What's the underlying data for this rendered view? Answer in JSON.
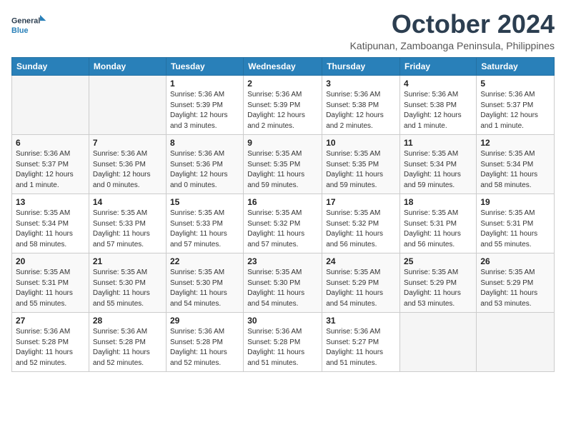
{
  "logo": {
    "line1": "General",
    "line2": "Blue"
  },
  "title": "October 2024",
  "location": "Katipunan, Zamboanga Peninsula, Philippines",
  "headers": [
    "Sunday",
    "Monday",
    "Tuesday",
    "Wednesday",
    "Thursday",
    "Friday",
    "Saturday"
  ],
  "weeks": [
    [
      {
        "day": "",
        "info": ""
      },
      {
        "day": "",
        "info": ""
      },
      {
        "day": "1",
        "info": "Sunrise: 5:36 AM\nSunset: 5:39 PM\nDaylight: 12 hours and 3 minutes."
      },
      {
        "day": "2",
        "info": "Sunrise: 5:36 AM\nSunset: 5:39 PM\nDaylight: 12 hours and 2 minutes."
      },
      {
        "day": "3",
        "info": "Sunrise: 5:36 AM\nSunset: 5:38 PM\nDaylight: 12 hours and 2 minutes."
      },
      {
        "day": "4",
        "info": "Sunrise: 5:36 AM\nSunset: 5:38 PM\nDaylight: 12 hours and 1 minute."
      },
      {
        "day": "5",
        "info": "Sunrise: 5:36 AM\nSunset: 5:37 PM\nDaylight: 12 hours and 1 minute."
      }
    ],
    [
      {
        "day": "6",
        "info": "Sunrise: 5:36 AM\nSunset: 5:37 PM\nDaylight: 12 hours and 1 minute."
      },
      {
        "day": "7",
        "info": "Sunrise: 5:36 AM\nSunset: 5:36 PM\nDaylight: 12 hours and 0 minutes."
      },
      {
        "day": "8",
        "info": "Sunrise: 5:36 AM\nSunset: 5:36 PM\nDaylight: 12 hours and 0 minutes."
      },
      {
        "day": "9",
        "info": "Sunrise: 5:35 AM\nSunset: 5:35 PM\nDaylight: 11 hours and 59 minutes."
      },
      {
        "day": "10",
        "info": "Sunrise: 5:35 AM\nSunset: 5:35 PM\nDaylight: 11 hours and 59 minutes."
      },
      {
        "day": "11",
        "info": "Sunrise: 5:35 AM\nSunset: 5:34 PM\nDaylight: 11 hours and 59 minutes."
      },
      {
        "day": "12",
        "info": "Sunrise: 5:35 AM\nSunset: 5:34 PM\nDaylight: 11 hours and 58 minutes."
      }
    ],
    [
      {
        "day": "13",
        "info": "Sunrise: 5:35 AM\nSunset: 5:34 PM\nDaylight: 11 hours and 58 minutes."
      },
      {
        "day": "14",
        "info": "Sunrise: 5:35 AM\nSunset: 5:33 PM\nDaylight: 11 hours and 57 minutes."
      },
      {
        "day": "15",
        "info": "Sunrise: 5:35 AM\nSunset: 5:33 PM\nDaylight: 11 hours and 57 minutes."
      },
      {
        "day": "16",
        "info": "Sunrise: 5:35 AM\nSunset: 5:32 PM\nDaylight: 11 hours and 57 minutes."
      },
      {
        "day": "17",
        "info": "Sunrise: 5:35 AM\nSunset: 5:32 PM\nDaylight: 11 hours and 56 minutes."
      },
      {
        "day": "18",
        "info": "Sunrise: 5:35 AM\nSunset: 5:31 PM\nDaylight: 11 hours and 56 minutes."
      },
      {
        "day": "19",
        "info": "Sunrise: 5:35 AM\nSunset: 5:31 PM\nDaylight: 11 hours and 55 minutes."
      }
    ],
    [
      {
        "day": "20",
        "info": "Sunrise: 5:35 AM\nSunset: 5:31 PM\nDaylight: 11 hours and 55 minutes."
      },
      {
        "day": "21",
        "info": "Sunrise: 5:35 AM\nSunset: 5:30 PM\nDaylight: 11 hours and 55 minutes."
      },
      {
        "day": "22",
        "info": "Sunrise: 5:35 AM\nSunset: 5:30 PM\nDaylight: 11 hours and 54 minutes."
      },
      {
        "day": "23",
        "info": "Sunrise: 5:35 AM\nSunset: 5:30 PM\nDaylight: 11 hours and 54 minutes."
      },
      {
        "day": "24",
        "info": "Sunrise: 5:35 AM\nSunset: 5:29 PM\nDaylight: 11 hours and 54 minutes."
      },
      {
        "day": "25",
        "info": "Sunrise: 5:35 AM\nSunset: 5:29 PM\nDaylight: 11 hours and 53 minutes."
      },
      {
        "day": "26",
        "info": "Sunrise: 5:35 AM\nSunset: 5:29 PM\nDaylight: 11 hours and 53 minutes."
      }
    ],
    [
      {
        "day": "27",
        "info": "Sunrise: 5:36 AM\nSunset: 5:28 PM\nDaylight: 11 hours and 52 minutes."
      },
      {
        "day": "28",
        "info": "Sunrise: 5:36 AM\nSunset: 5:28 PM\nDaylight: 11 hours and 52 minutes."
      },
      {
        "day": "29",
        "info": "Sunrise: 5:36 AM\nSunset: 5:28 PM\nDaylight: 11 hours and 52 minutes."
      },
      {
        "day": "30",
        "info": "Sunrise: 5:36 AM\nSunset: 5:28 PM\nDaylight: 11 hours and 51 minutes."
      },
      {
        "day": "31",
        "info": "Sunrise: 5:36 AM\nSunset: 5:27 PM\nDaylight: 11 hours and 51 minutes."
      },
      {
        "day": "",
        "info": ""
      },
      {
        "day": "",
        "info": ""
      }
    ]
  ]
}
